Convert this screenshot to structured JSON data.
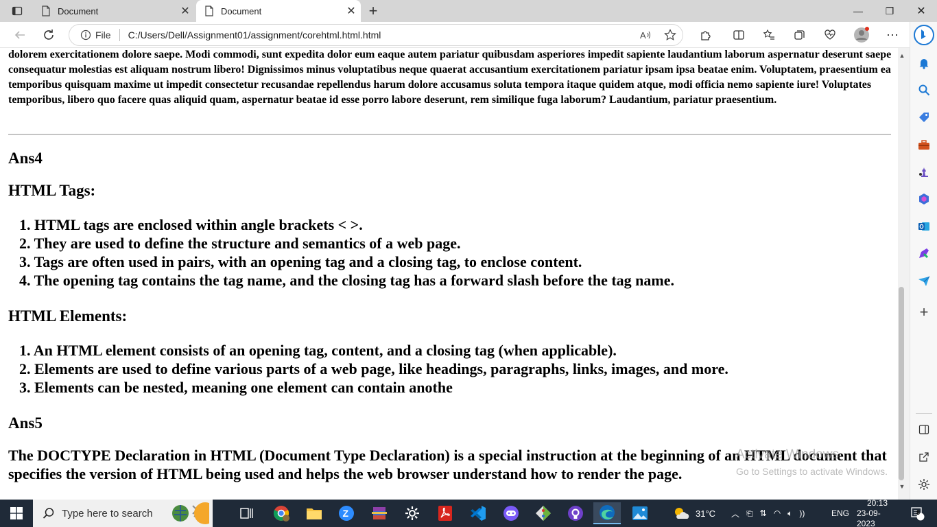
{
  "browser": {
    "tabs": [
      {
        "title": "Document"
      },
      {
        "title": "Document"
      }
    ],
    "address": {
      "scheme_label": "File",
      "url": "C:/Users/Dell/Assignment01/assignment/corehtml.html.html"
    }
  },
  "page": {
    "intro_text": "dolorem exercitationem dolore saepe. Modi commodi, sunt expedita dolor eum eaque autem pariatur quibusdam asperiores impedit sapiente laudantium laborum aspernatur deserunt saepe consequatur molestias est aliquam nostrum libero! Dignissimos minus voluptatibus neque quaerat accusantium exercitationem pariatur ipsam ipsa beatae enim. Voluptatem, praesentium ea temporibus quisquam maxime ut impedit consectetur recusandae repellendus harum dolore accusamus soluta tempora itaque quidem atque, modi officia nemo sapiente iure! Voluptates temporibus, libero quo facere quas aliquid quam, aspernatur beatae id esse porro labore deserunt, rem similique fuga laborum? Laudantium, pariatur praesentium.",
    "ans4_heading": "Ans4",
    "tags_heading": "HTML Tags:",
    "tags_list": [
      "1. HTML tags are enclosed within angle brackets < >.",
      "2. They are used to define the structure and semantics of a web page.",
      "3. Tags are often used in pairs, with an opening tag and a closing tag, to enclose content.",
      "4. The opening tag contains the tag name, and the closing tag has a forward slash before the tag name."
    ],
    "elements_heading": "HTML Elements:",
    "elements_list": [
      "1. An HTML element consists of an opening tag, content, and a closing tag (when applicable).",
      "2. Elements are used to define various parts of a web page, like headings, paragraphs, links, images, and more.",
      "3. Elements can be nested, meaning one element can contain anothe"
    ],
    "ans5_heading": "Ans5",
    "doctype_paragraph": "The DOCTYPE Declaration in HTML (Document Type Declaration) is a special instruction at the beginning of an HTML document that specifies the version of HTML being used and helps the web browser understand how to render the page."
  },
  "watermark": {
    "line1": "Activate Windows",
    "line2": "Go to Settings to activate Windows."
  },
  "taskbar": {
    "search_placeholder": "Type here to search",
    "weather": "31°C",
    "language": "ENG",
    "time": "20:13",
    "date": "23-09-2023",
    "notification_count": "8"
  },
  "colors": {
    "taskbar_bg": "#1f2a38",
    "tab_strip_bg": "#d6d6d6",
    "edge_accent": "#0f6cbd"
  }
}
